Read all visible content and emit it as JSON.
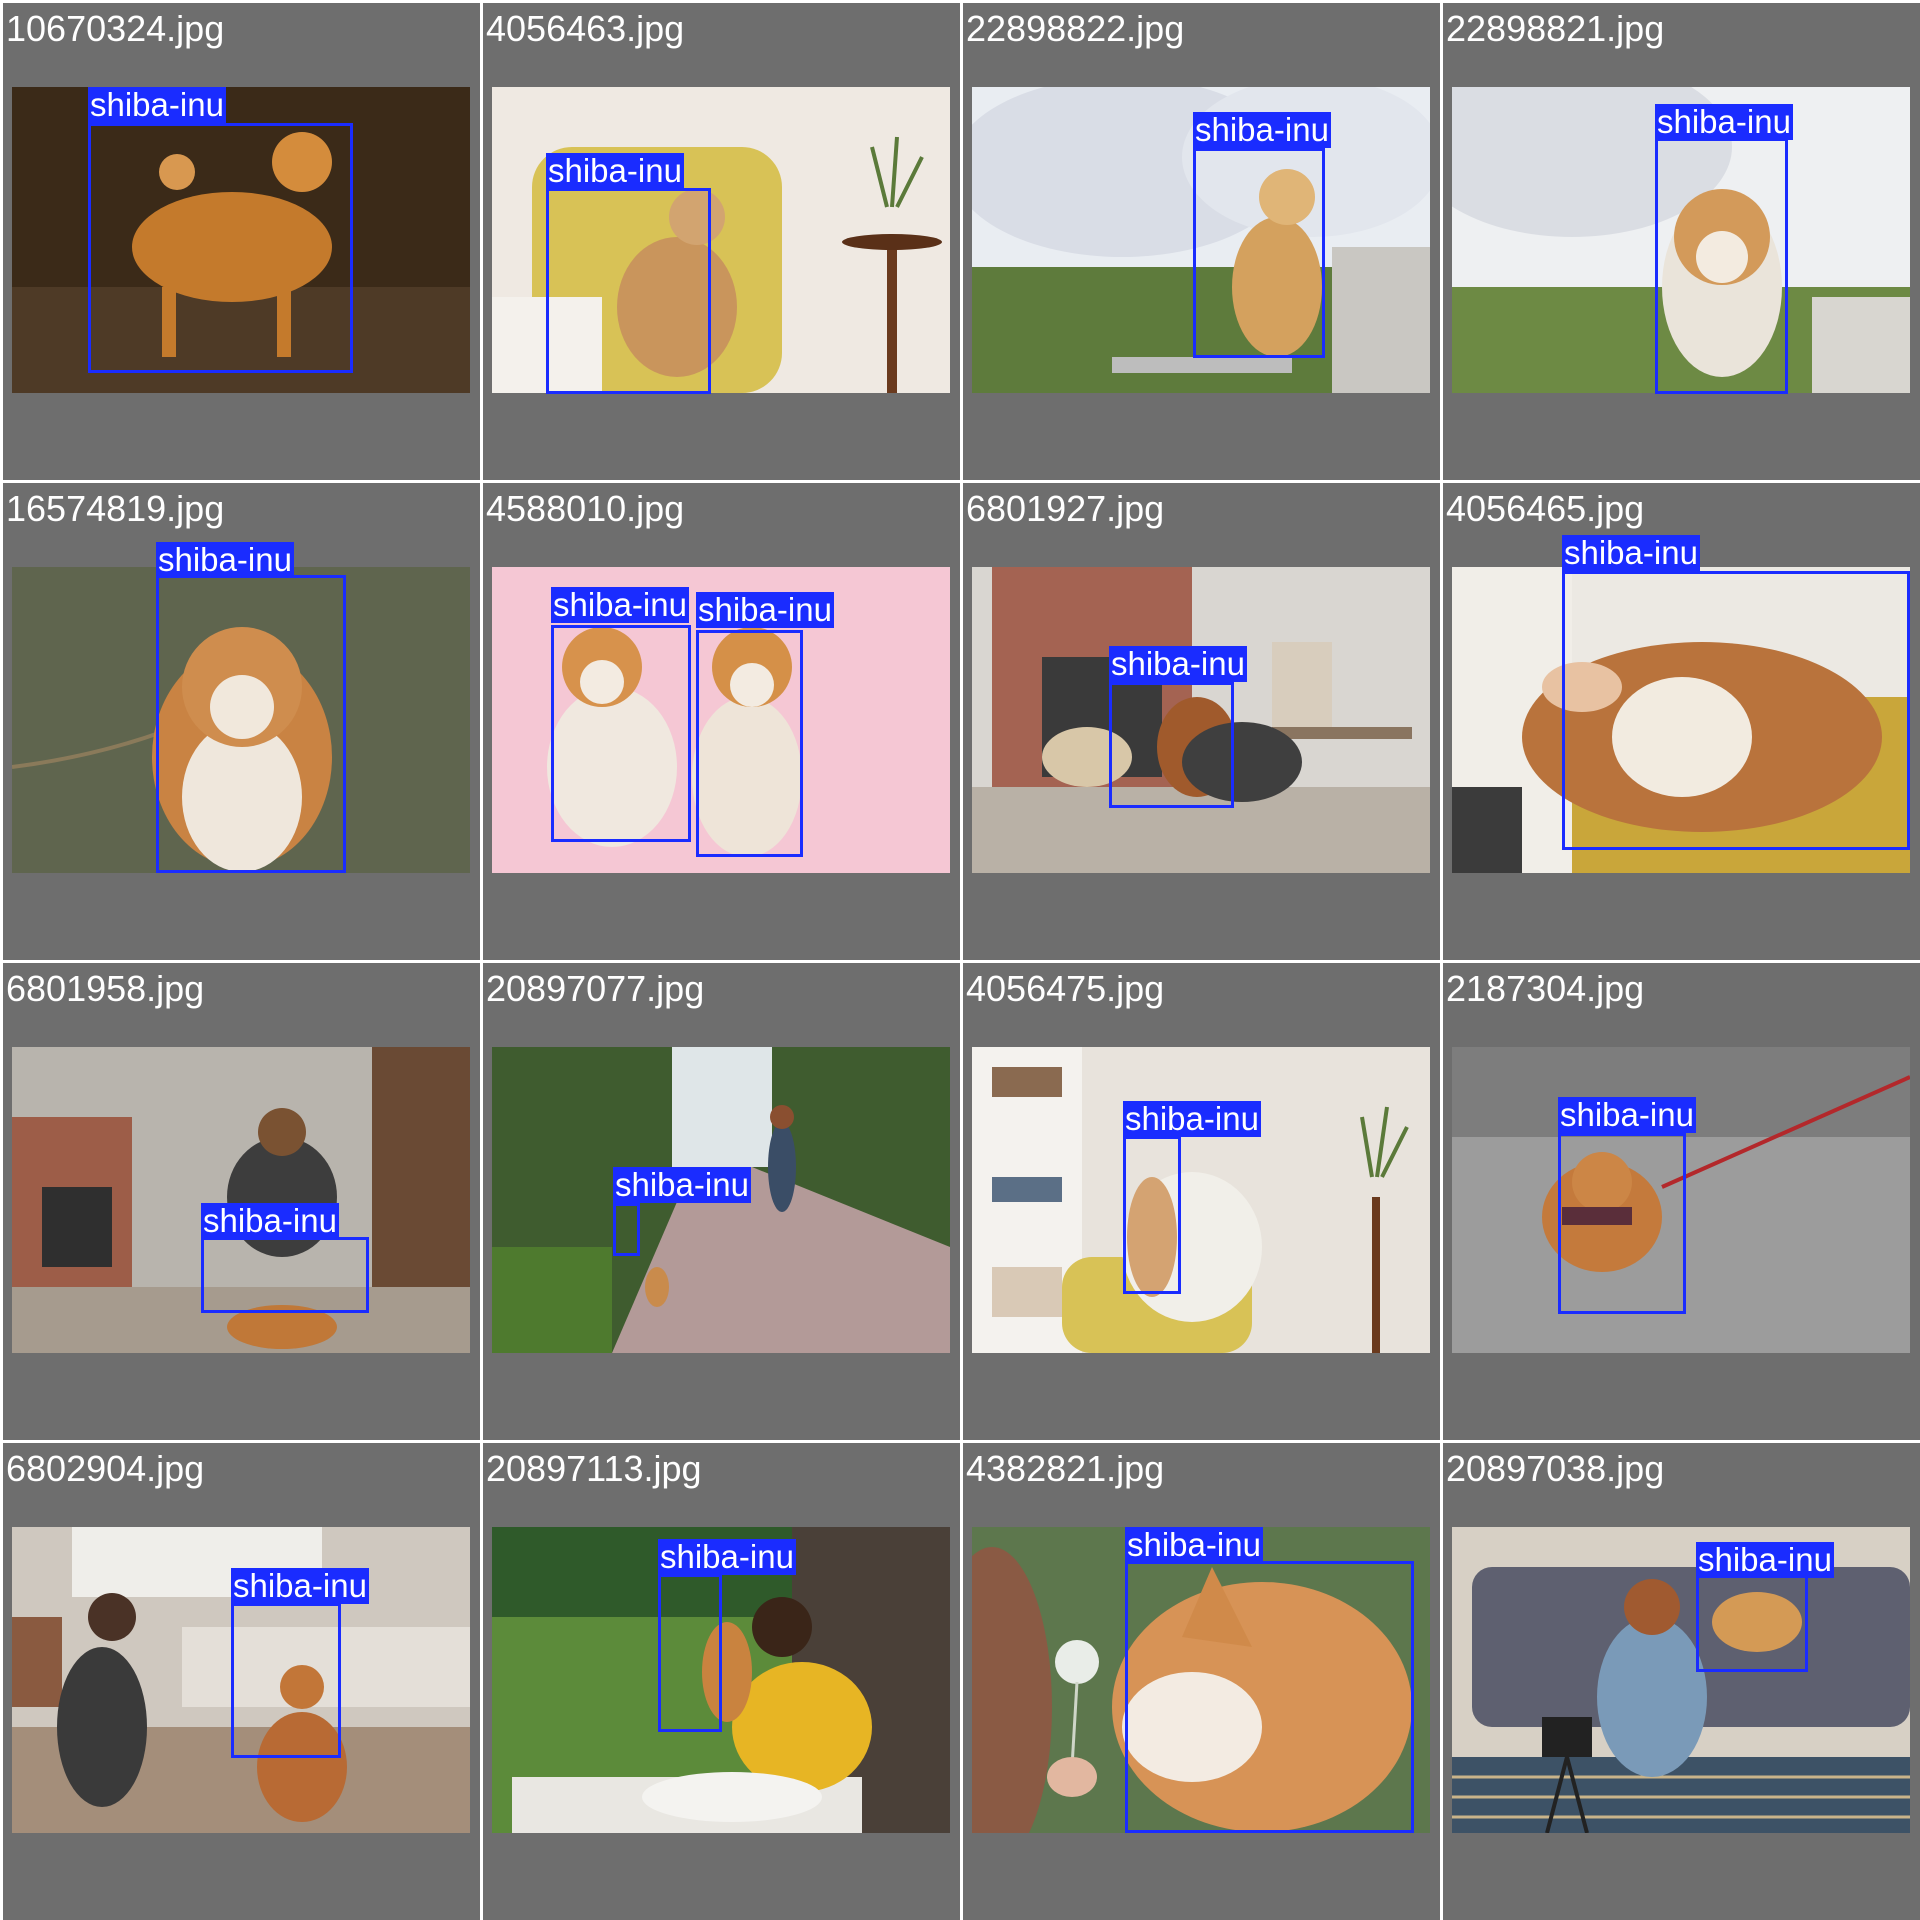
{
  "detection_label": "shiba-inu",
  "colors": {
    "tile_bg": "#6e6e6e",
    "box": "#1a2cff",
    "label_text": "#ffffff"
  },
  "tiles": [
    {
      "filename": "10670324.jpg",
      "scene": "dark-forest-floor"
    },
    {
      "filename": "4056463.jpg",
      "scene": "yellow-armchair-room"
    },
    {
      "filename": "22898822.jpg",
      "scene": "cherry-blossom-park"
    },
    {
      "filename": "22898821.jpg",
      "scene": "cherry-blossom-closeup"
    },
    {
      "filename": "16574819.jpg",
      "scene": "grass-closeup"
    },
    {
      "filename": "4588010.jpg",
      "scene": "pink-studio"
    },
    {
      "filename": "6801927.jpg",
      "scene": "brick-fireplace-room"
    },
    {
      "filename": "4056465.jpg",
      "scene": "yellow-couch-closeup"
    },
    {
      "filename": "6801958.jpg",
      "scene": "living-room-reading"
    },
    {
      "filename": "20897077.jpg",
      "scene": "park-walkway"
    },
    {
      "filename": "4056475.jpg",
      "scene": "bookshelf-room"
    },
    {
      "filename": "2187304.jpg",
      "scene": "paved-sidewalk"
    },
    {
      "filename": "6802904.jpg",
      "scene": "bedroom-floor"
    },
    {
      "filename": "20897113.jpg",
      "scene": "tree-picnic"
    },
    {
      "filename": "4382821.jpg",
      "scene": "dandelion-meadow"
    },
    {
      "filename": "20897038.jpg",
      "scene": "sofa-vlogging"
    }
  ]
}
